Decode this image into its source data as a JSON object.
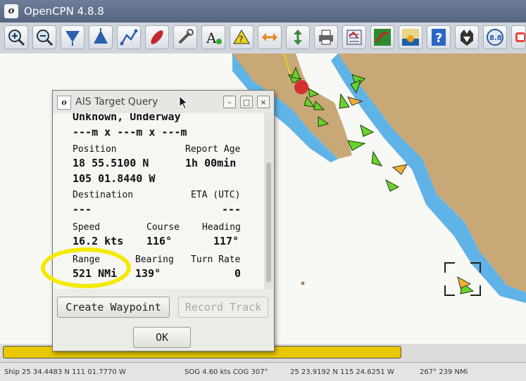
{
  "window": {
    "title": "OpenCPN 4.8.8",
    "logo": "opencpn-logo",
    "logo_letter": "o"
  },
  "toolbar": {
    "items": [
      {
        "name": "zoom-in-icon"
      },
      {
        "name": "zoom-out-icon"
      },
      {
        "name": "scale-down-icon"
      },
      {
        "name": "scale-up-icon"
      },
      {
        "name": "route-icon"
      },
      {
        "name": "track-icon"
      },
      {
        "name": "settings-wrench-icon"
      },
      {
        "name": "text-icon"
      },
      {
        "name": "mark-icon"
      },
      {
        "name": "center-ship-icon"
      },
      {
        "name": "course-up-icon"
      },
      {
        "name": "print-icon"
      },
      {
        "name": "route-manager-icon"
      },
      {
        "name": "tracks-icon"
      },
      {
        "name": "day-night-icon"
      },
      {
        "name": "help-icon"
      },
      {
        "name": "ais-icon"
      },
      {
        "name": "version-badge-icon"
      },
      {
        "name": "tide-icon"
      }
    ],
    "version_badge": "8.8"
  },
  "dialog": {
    "title": "AIS Target Query",
    "logo_letter": "o",
    "controls": {
      "minimize": "–",
      "maximize": "□",
      "close": "×"
    },
    "header_line1": "Unknown, Underway",
    "header_line2": "---m x ---m x ---m",
    "position_label": "Position",
    "position_lat": "18 55.5100 N",
    "position_lon": "105 01.8440 W",
    "report_age_label": "Report Age",
    "report_age_value": "1h 00min",
    "destination_label": "Destination",
    "destination_value": "---",
    "eta_label": "ETA (UTC)",
    "eta_value": "---",
    "speed_label": "Speed",
    "speed_value": "16.2 kts",
    "course_label": "Course",
    "course_value": "116°",
    "heading_label": "Heading",
    "heading_value": "117°",
    "range_label": "Range",
    "range_value": "521 NMi",
    "bearing_label": "Bearing",
    "bearing_value": "139°",
    "turn_rate_label": "Turn Rate",
    "turn_rate_value": "0",
    "create_waypoint_label": "Create Waypoint",
    "record_track_label": "Record Track",
    "ok_label": "OK"
  },
  "status": {
    "ship": "Ship 25 34.4483 N   111 01.7770 W",
    "sog": "SOG 4.60 kts  COG 307°",
    "cursor": "25 23.9192 N   115 24.6251 W",
    "range": "267°  239 NMi"
  },
  "colors": {
    "land": "#c9a877",
    "water_shallow": "#5fb3e6",
    "water_deep": "#f8f8f4",
    "ais_target": "#6ad12d",
    "highlight": "#f4ea00",
    "progress": "#e8c800"
  }
}
